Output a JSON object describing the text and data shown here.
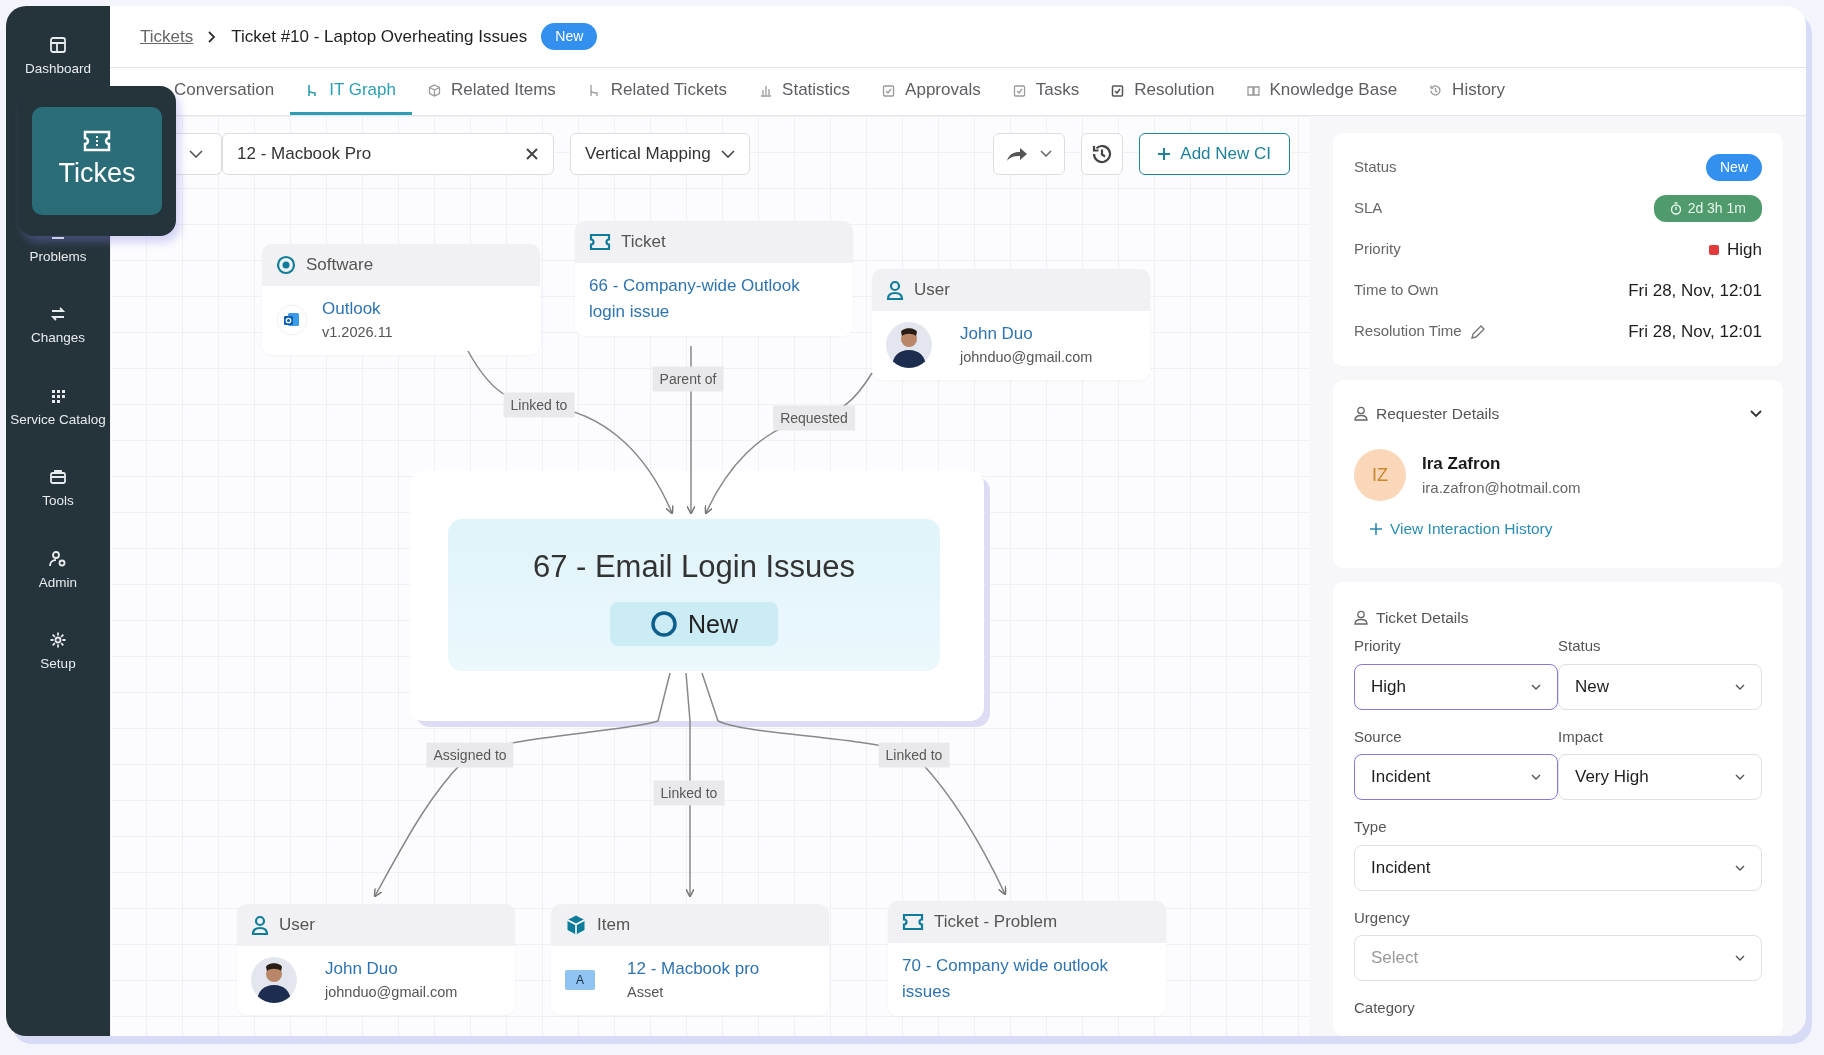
{
  "sidebar": {
    "items": [
      {
        "label": "Dashboard"
      },
      {
        "label": "Problems"
      },
      {
        "label": "Changes"
      },
      {
        "label": "Service Catalog"
      },
      {
        "label": "Tools"
      },
      {
        "label": "Admin"
      },
      {
        "label": "Setup"
      }
    ],
    "popup": {
      "label": "Tickes"
    }
  },
  "breadcrumb": {
    "parent": "Tickets",
    "current": "Ticket #10 - Laptop Overheating Issues",
    "badge": "New"
  },
  "tabs": [
    {
      "label": "Conversation",
      "selected": false
    },
    {
      "label": "IT Graph",
      "selected": true
    },
    {
      "label": "Related Items",
      "selected": false
    },
    {
      "label": "Related Tickets",
      "selected": false
    },
    {
      "label": "Statistics",
      "selected": false
    },
    {
      "label": "Approvals",
      "selected": false
    },
    {
      "label": "Tasks",
      "selected": false
    },
    {
      "label": "Resolution",
      "selected": false
    },
    {
      "label": "Knowledge Base",
      "selected": false
    },
    {
      "label": "History",
      "selected": false
    }
  ],
  "toolbar": {
    "search_value": "12 - Macbook Pro",
    "mapping": "Vertical Mapping",
    "add_button": "Add New CI"
  },
  "graph": {
    "center": {
      "title": "67 - Email Login Issues",
      "status": "New"
    },
    "nodes": [
      {
        "kind": "software",
        "title": "Software",
        "link": "Outlook",
        "sub": "v1.2026.11"
      },
      {
        "kind": "ticket",
        "title": "Ticket",
        "link": "66 - Company-wide Outlook login issue"
      },
      {
        "kind": "user",
        "title": "User",
        "link": "John Duo",
        "sub": "johnduo@gmail.com"
      },
      {
        "kind": "user",
        "title": "User",
        "link": "John Duo",
        "sub": "johnduo@gmail.com"
      },
      {
        "kind": "item",
        "title": "Item",
        "badge": "A",
        "link": "12 - Macbook pro",
        "sub": "Asset"
      },
      {
        "kind": "ticket",
        "title": "Ticket - Problem",
        "link": "70 - Company wide outlook issues"
      }
    ],
    "edges": [
      {
        "label": "Linked to"
      },
      {
        "label": "Parent of"
      },
      {
        "label": "Requested"
      },
      {
        "label": "Assigned to"
      },
      {
        "label": "Linked to"
      },
      {
        "label": "Linked to"
      }
    ]
  },
  "summary": [
    {
      "kind": "badge",
      "label": "Status",
      "value": "New"
    },
    {
      "kind": "timer",
      "label": "SLA",
      "value": "2d 3h 1m"
    },
    {
      "kind": "priority",
      "label": "Priority",
      "value": "High"
    },
    {
      "kind": "text",
      "label": "Time to Own",
      "value": "Fri 28, Nov, 12:01"
    },
    {
      "kind": "text",
      "label": "Resolution Time",
      "value": "Fri 28, Nov, 12:01",
      "editable": true
    }
  ],
  "requester": {
    "title": "Requester Details",
    "initials": "IZ",
    "name": "Ira Zafron",
    "email": "ira.zafron@hotmail.com",
    "link": "View Interaction History"
  },
  "ticket_details": {
    "title": "Ticket Details",
    "fields": [
      {
        "label": "Priority",
        "value": "High",
        "focused": true
      },
      {
        "label": "Status",
        "value": "New",
        "focused": false
      },
      {
        "label": "Source",
        "value": "Incident",
        "focused": true
      },
      {
        "label": "Impact",
        "value": "Very High",
        "focused": false
      },
      {
        "label": "Type",
        "value": "Incident",
        "focused": false
      },
      {
        "label": "Urgency",
        "placeholder": "Select",
        "focused": false
      },
      {
        "label": "Category"
      }
    ]
  }
}
